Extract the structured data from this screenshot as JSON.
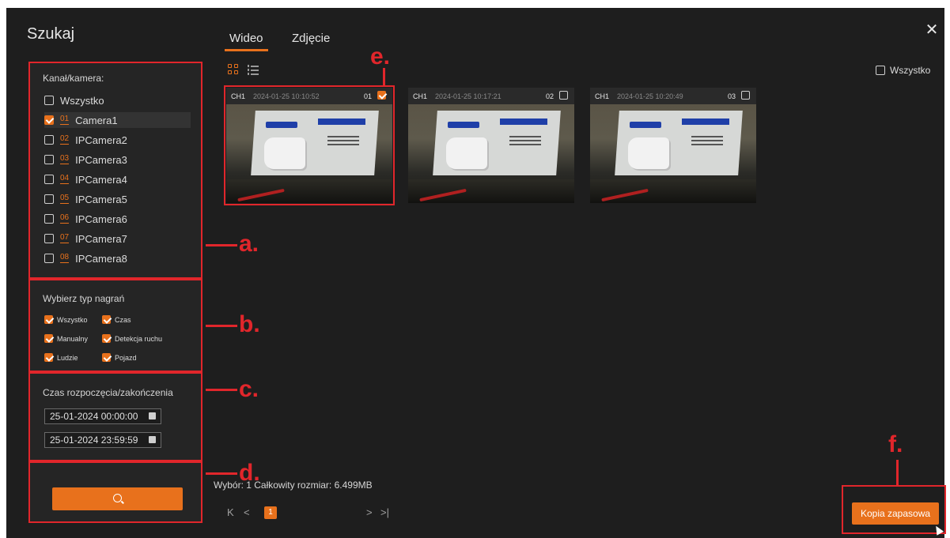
{
  "window": {
    "title": "Szukaj",
    "close_icon": "close-icon"
  },
  "tabs": [
    {
      "label": "Wideo",
      "active": true
    },
    {
      "label": "Zdjęcie",
      "active": false
    }
  ],
  "channels": {
    "label": "Kanał/kamera:",
    "all_label": "Wszystko",
    "items": [
      {
        "num": "01",
        "name": "Camera1",
        "checked": true
      },
      {
        "num": "02",
        "name": "IPCamera2",
        "checked": false
      },
      {
        "num": "03",
        "name": "IPCamera3",
        "checked": false
      },
      {
        "num": "04",
        "name": "IPCamera4",
        "checked": false
      },
      {
        "num": "05",
        "name": "IPCamera5",
        "checked": false
      },
      {
        "num": "06",
        "name": "IPCamera6",
        "checked": false
      },
      {
        "num": "07",
        "name": "IPCamera7",
        "checked": false
      },
      {
        "num": "08",
        "name": "IPCamera8",
        "checked": false
      }
    ]
  },
  "record_types": {
    "label": "Wybierz typ nagrań",
    "items": [
      {
        "label": "Wszystko",
        "checked": true
      },
      {
        "label": "Czas",
        "checked": true
      },
      {
        "label": "Manualny",
        "checked": true
      },
      {
        "label": "Detekcja ruchu",
        "checked": true
      },
      {
        "label": "Ludzie",
        "checked": true
      },
      {
        "label": "Pojazd",
        "checked": true
      }
    ]
  },
  "time_range": {
    "label": "Czas rozpoczęcia/zakończenia",
    "start": "25-01-2024 00:00:00",
    "end": "25-01-2024 23:59:59"
  },
  "search_button_icon": "search-icon",
  "select_all_label": "Wszystko",
  "thumbnails": [
    {
      "channel": "CH1",
      "timestamp": "2024-01-25 10:10:52",
      "index": "01",
      "checked": true
    },
    {
      "channel": "CH1",
      "timestamp": "2024-01-25 10:17:21",
      "index": "02",
      "checked": false
    },
    {
      "channel": "CH1",
      "timestamp": "2024-01-25 10:20:49",
      "index": "03",
      "checked": false
    }
  ],
  "status_text": "Wybór: 1 Całkowity rozmiar: 6.499MB",
  "pagination": {
    "first": "K",
    "prev": "<",
    "current": "1",
    "next": ">",
    "last": ">|"
  },
  "backup_label": "Kopia zapasowa",
  "annotations": [
    "a.",
    "b.",
    "c.",
    "d.",
    "e.",
    "f."
  ],
  "colors": {
    "accent": "#e8711c",
    "annotation": "#e1262b",
    "background": "#1e1e1e"
  }
}
